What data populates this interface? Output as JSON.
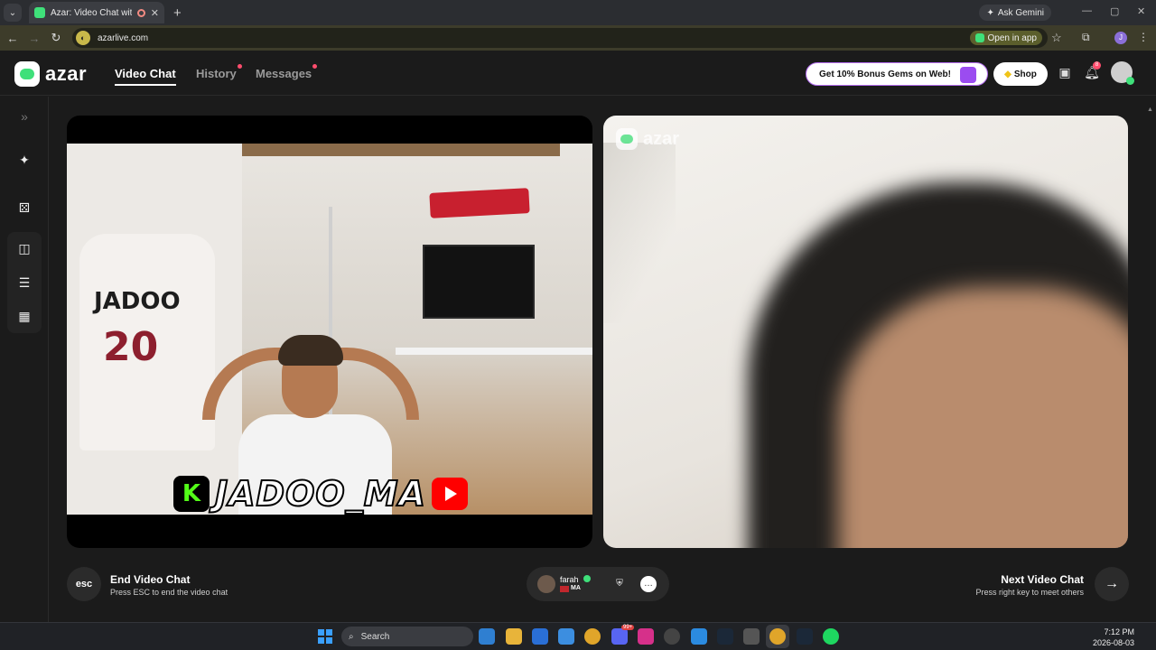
{
  "browser": {
    "tab_title": "Azar: Video Chat with New",
    "ask_gemini": "Ask Gemini",
    "url": "azarlive.com",
    "open_in_app": "Open in app",
    "profile_initial": "J"
  },
  "app": {
    "logo_text": "azar",
    "nav": {
      "video_chat": "Video Chat",
      "history": "History",
      "messages": "Messages"
    },
    "promo": "Get 10% Bonus Gems on Web!",
    "shop": "Shop",
    "notification_count": "8"
  },
  "video": {
    "left": {
      "jersey_name": "JADOO",
      "jersey_number": "20",
      "overlay_name": "JADOO_MA"
    },
    "right": {
      "watermark": "azar"
    }
  },
  "controls": {
    "esc_label": "esc",
    "end_title": "End Video Chat",
    "end_sub": "Press ESC to end the video chat",
    "partner_name": "farah",
    "partner_country": "MA",
    "next_title": "Next Video Chat",
    "next_sub": "Press right key to meet others"
  },
  "taskbar": {
    "search": "Search",
    "discord_badge": "99+",
    "time": "7:12 PM",
    "date": "2026-08-03"
  },
  "colors": {
    "brand_green": "#3fe07a",
    "notification_red": "#ff4d6d",
    "promo_purple": "#9b4cf0"
  }
}
